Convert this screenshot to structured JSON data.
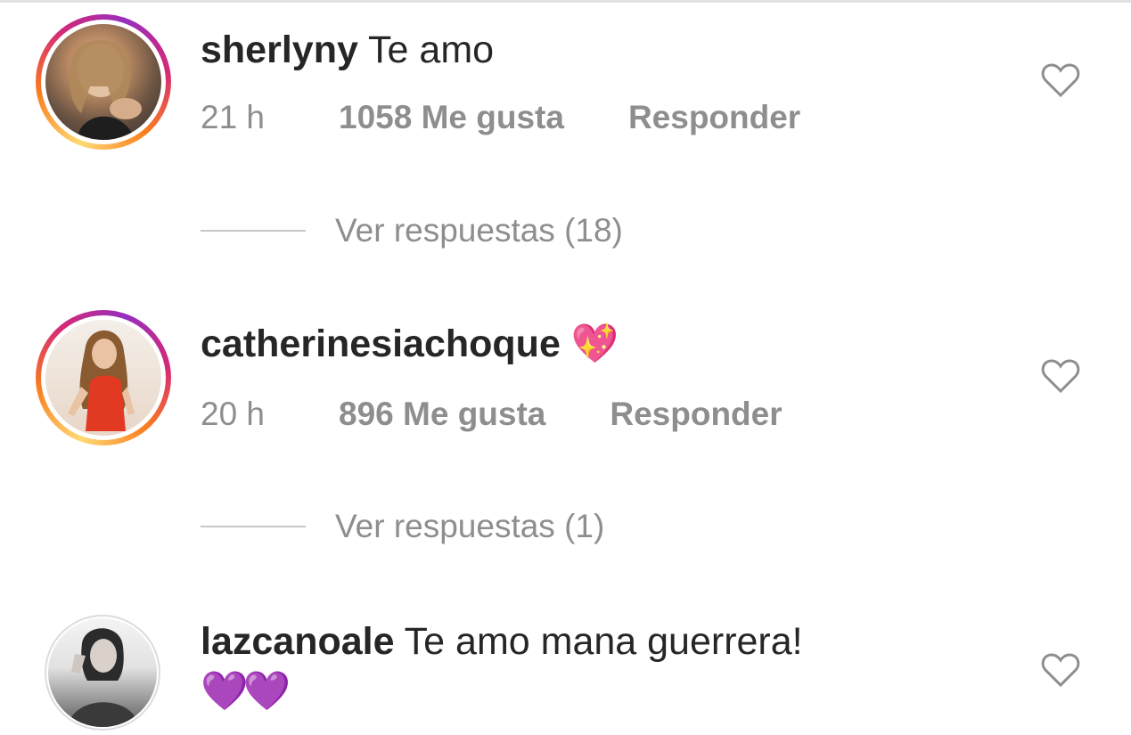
{
  "comments": [
    {
      "username": "sherlyny",
      "text": "Te amo",
      "time": "21 h",
      "likes": "1058 Me gusta",
      "reply": "Responder",
      "view_replies": "Ver respuestas (18)",
      "avatar_ring": true
    },
    {
      "username": "catherinesiachoque",
      "text": "💖",
      "time": "20 h",
      "likes": "896 Me gusta",
      "reply": "Responder",
      "view_replies": "Ver respuestas (1)",
      "avatar_ring": true
    },
    {
      "username": "lazcanoale",
      "text": "Te amo mana guerrera!",
      "text_line2": "💜💜",
      "avatar_ring": false
    }
  ],
  "icons": {
    "like": "heart-outline-icon"
  },
  "colors": {
    "meta_text": "#8e8e8e",
    "primary_text": "#262626",
    "divider": "#c7c7c7"
  }
}
